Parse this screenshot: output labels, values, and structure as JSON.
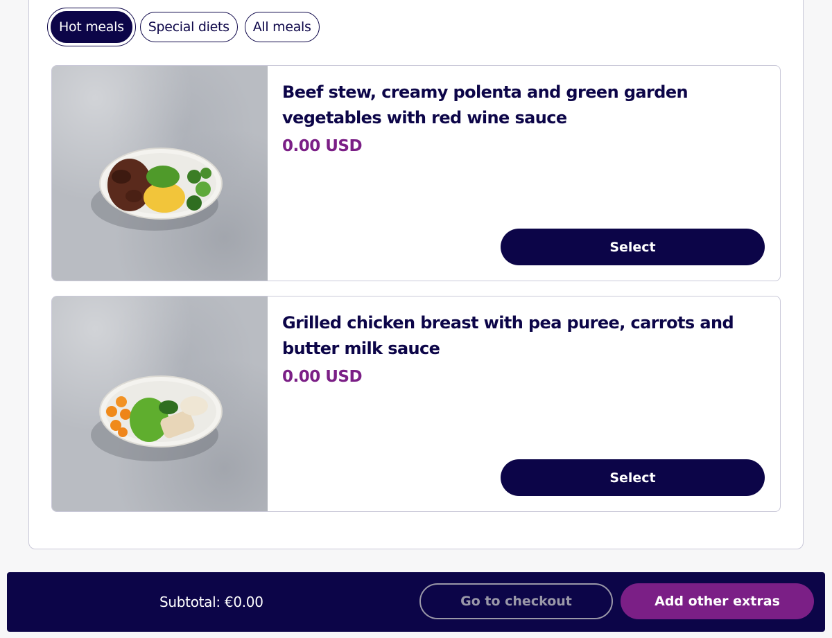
{
  "filters": {
    "items": [
      {
        "label": "Hot meals",
        "active": true
      },
      {
        "label": "Special diets",
        "active": false
      },
      {
        "label": "All meals",
        "active": false
      }
    ]
  },
  "meals": [
    {
      "title": "Beef stew, creamy polenta and green garden vegetables with red wine sauce",
      "price": "0.00 USD",
      "select_label": "Select",
      "image": "beef-stew-photo"
    },
    {
      "title": "Grilled chicken breast with pea puree, carrots and butter milk sauce",
      "price": "0.00 USD",
      "select_label": "Select",
      "image": "grilled-chicken-photo"
    }
  ],
  "footer": {
    "subtotal": "Subtotal: €0.00",
    "checkout_label": "Go to checkout",
    "extras_label": "Add other extras"
  },
  "colors": {
    "navy": "#0c0548",
    "purple": "#7b1f86",
    "border": "#c9c8d8"
  }
}
